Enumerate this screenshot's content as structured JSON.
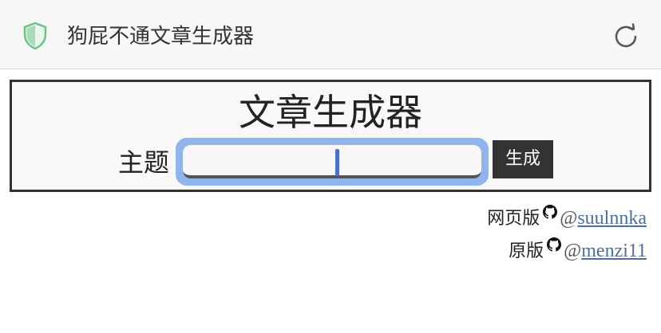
{
  "browser": {
    "site_title": "狗屁不通文章生成器",
    "security_icon": "shield-icon",
    "reload_icon": "reload-icon"
  },
  "generator": {
    "heading": "文章生成器",
    "topic_label": "主题",
    "topic_value": "",
    "generate_label": "生成"
  },
  "credits": {
    "web_label": "网页版",
    "web_at": "@",
    "web_user": "suulnnka",
    "original_label": "原版",
    "original_at": "@",
    "original_user": "menzi11",
    "icon": "github-icon"
  },
  "colors": {
    "accent_focus": "#8fb5ec",
    "button_bg": "#333333",
    "link": "#4a6fa5",
    "shield": "#6cc08a"
  }
}
